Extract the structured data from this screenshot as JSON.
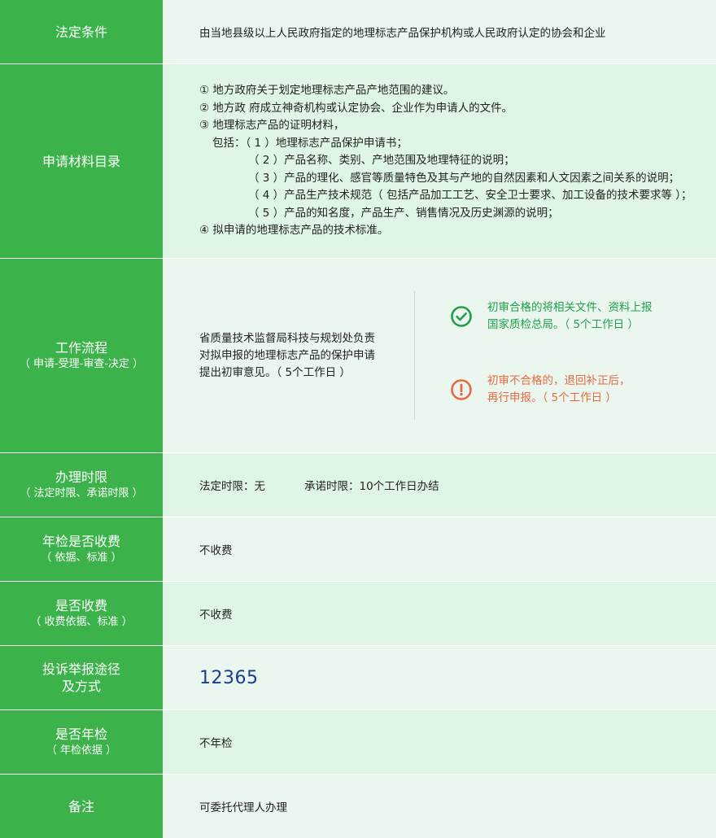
{
  "rows": {
    "legal_conditions": {
      "label": "法定条件",
      "value": "由当地县级以上人民政府指定的地理标志产品保护机构或人民政府认定的协会和企业"
    },
    "materials": {
      "label": "申请材料目录",
      "lines": [
        "① 地方政府关于划定地理标志产品产地范围的建议。",
        "② 地方政 府成立神奇机构或认定协会、企业作为申请人的文件。",
        "③ 地理标志产品的证明材料，",
        "包括：（ 1 ）地理标志产品保护申请书；",
        "（ 2 ）产品名称、类别、产地范围及地理特征的说明；",
        "（ 3 ）产品的理化、感官等质量特色及其与产地的自然因素和人文因素之间关系的说明；",
        "（ 4 ）产品生产技术规范（ 包括产品加工工艺、安全卫士要求、加工设备的技术要求等 ）；",
        "（ 5 ）产品的知名度，产品生产、销售情况及历史渊源的说明；",
        "④ 拟申请的地理标志产品的技术标准。"
      ]
    },
    "workflow": {
      "label": "工作流程",
      "sub": "（ 申请-受理-审查-决定 ）",
      "step_lines": [
        "省质量技术监督局科技与规划处负责",
        "对拟申报的地理标志产品的保护申请",
        "提出初审意见。（ 5个工作日 ）"
      ],
      "pass_lines": [
        "初审合格的将相关文件、资料上报",
        "国家质检总局。（ 5个工作日 ）"
      ],
      "fail_lines": [
        "初审不合格的，退回补正后，",
        "再行申报。（ 5个工作日 ）"
      ],
      "pass_color": "#1fa14a",
      "fail_color": "#e66a42",
      "pass_icon": "check-circle-icon",
      "fail_icon": "exclamation-circle-icon"
    },
    "time_limit": {
      "label": "办理时限",
      "sub": "（ 法定时限、承诺时限 ）",
      "legal": "法定时限：无",
      "promise": "承诺时限：10个工作日办结"
    },
    "annual_fee": {
      "label": "年检是否收费",
      "sub": "（ 依据、标准 ）",
      "value": "不收费"
    },
    "fee": {
      "label": "是否收费",
      "sub": "（ 收费依据、标准 ）",
      "value": "不收费"
    },
    "complaint": {
      "label_line1": "投诉举报途径",
      "label_line2": "及方式",
      "value": "12365",
      "value_color": "#1a3d8f"
    },
    "annual_check": {
      "label": "是否年检",
      "sub": "（ 年检依据 ）",
      "value": "不年检"
    },
    "remarks": {
      "label": "备注",
      "value": "可委托代理人办理"
    }
  },
  "colors": {
    "label_bg": "#3bb34a",
    "row_bg_a": "#ebf6ee",
    "row_bg_b": "#dff6e6"
  }
}
